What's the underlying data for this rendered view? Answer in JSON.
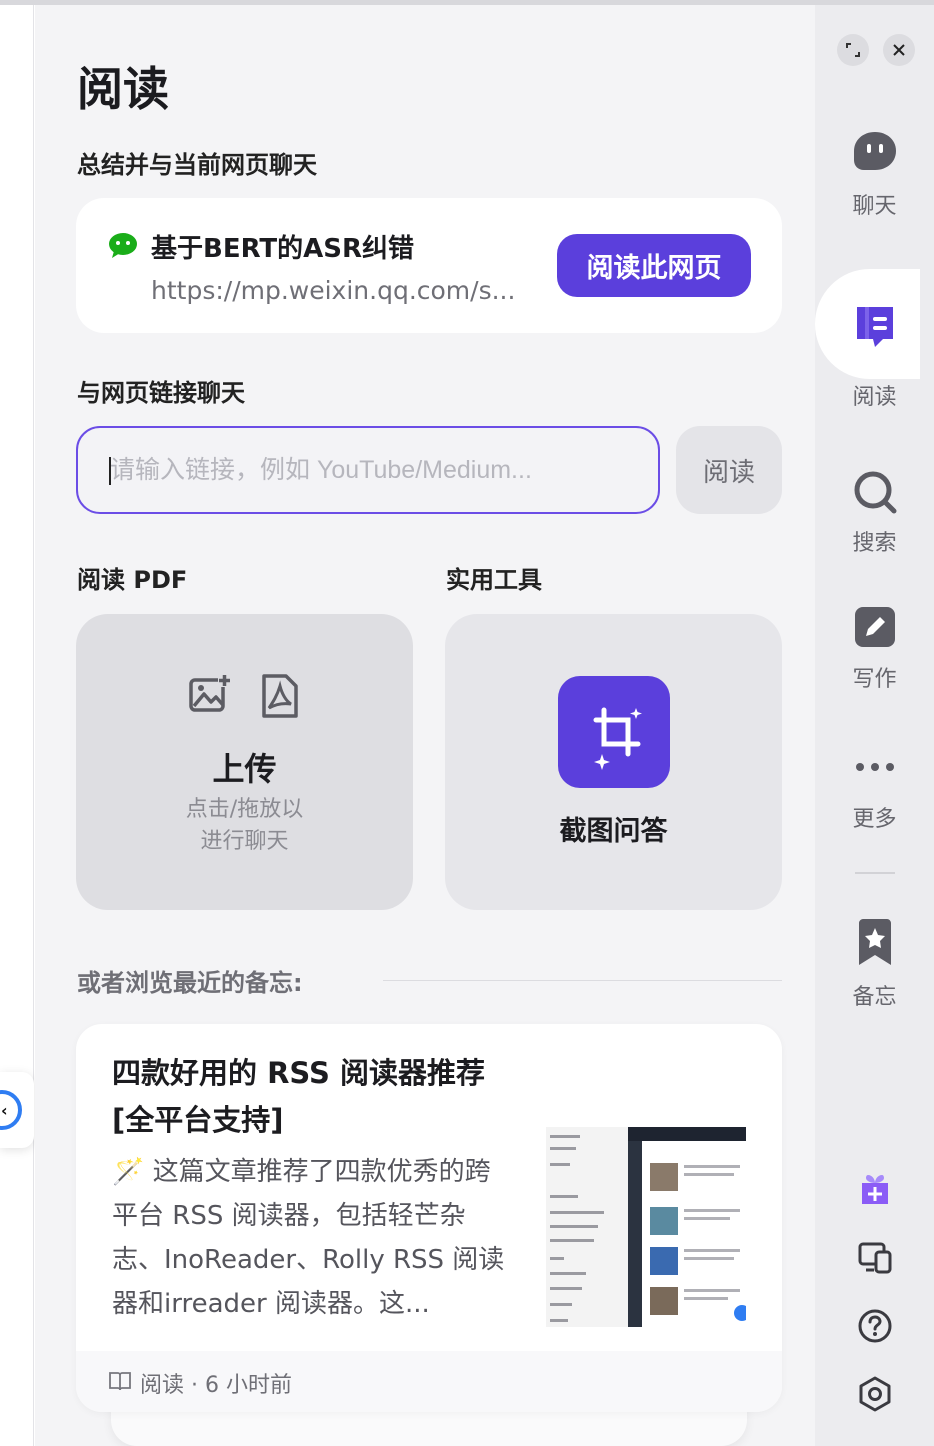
{
  "main": {
    "title": "阅读",
    "summary_section_title": "总结并与当前网页聊天",
    "current_page": {
      "title": "基于BERT的ASR纠错",
      "url": "https://mp.weixin.qq.com/s...",
      "button_label": "阅读此网页"
    },
    "link_section_title": "与网页链接聊天",
    "link_input": {
      "value": "",
      "placeholder": "请输入链接，例如 YouTube/Medium...",
      "button_label": "阅读"
    },
    "pdf_section_title": "阅读 PDF",
    "tools_section_title": "实用工具",
    "upload": {
      "title": "上传",
      "subtitle_line1": "点击/拖放以",
      "subtitle_line2": "进行聊天"
    },
    "screenshot_tool": {
      "label": "截图问答"
    },
    "recent_label": "或者浏览最近的备忘:",
    "recent_memo": {
      "title": "四款好用的 RSS 阅读器推荐[全平台支持]",
      "summary": "这篇文章推荐了四款优秀的跨平台 RSS 阅读器，包括轻芒杂志、InoReader、Rolly RSS 阅读器和irreader 阅读器。这...",
      "summary_icon": "magic-wand-icon",
      "footer": "阅读 · 6 小时前"
    }
  },
  "sidebar": {
    "window_buttons": [
      "expand-icon",
      "close-icon"
    ],
    "items": [
      {
        "label": "聊天",
        "icon": "chat-bubble-icon",
        "active": false
      },
      {
        "label": "阅读",
        "icon": "read-book-icon",
        "active": true
      },
      {
        "label": "搜索",
        "icon": "search-icon",
        "active": false
      },
      {
        "label": "写作",
        "icon": "write-pencil-icon",
        "active": false
      },
      {
        "label": "更多",
        "icon": "more-dots-icon",
        "active": false
      },
      {
        "label": "备忘",
        "icon": "bookmark-star-icon",
        "active": false
      }
    ],
    "bottom_icons": [
      "gift-icon",
      "devices-icon",
      "help-icon",
      "settings-icon"
    ]
  },
  "colors": {
    "accent": "#5b3fdc",
    "background": "#f4f4f6",
    "sidebar": "#ececef",
    "wechat": "#1aad19"
  }
}
